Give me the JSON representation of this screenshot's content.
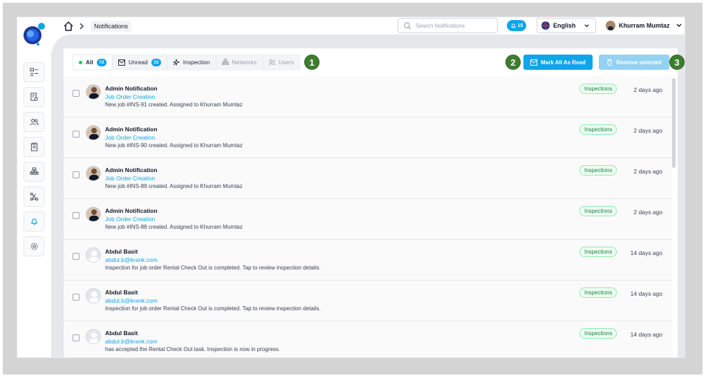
{
  "header": {
    "breadcrumb": "Notifications",
    "search_placeholder": "Search Notifications",
    "bell_count": "15",
    "language": "English",
    "user_name": "Khurram Mumtaz"
  },
  "sidebar": {
    "icons": [
      "dashboard-icon",
      "report-search-icon",
      "users-icon",
      "clipboard-icon",
      "network-icon",
      "workflow-icon",
      "bell-icon",
      "settings-icon"
    ],
    "active_index": 6
  },
  "tabs": [
    {
      "label": "All",
      "count": "72",
      "active": true
    },
    {
      "label": "Unread",
      "count": "15"
    },
    {
      "label": "Inspection"
    },
    {
      "label": "Networks"
    },
    {
      "label": "Users"
    }
  ],
  "markers": [
    "1",
    "2",
    "3"
  ],
  "actions": {
    "mark_all": "Mark All As Read",
    "remove": "Remove selected"
  },
  "notifications": [
    {
      "title": "Admin Notification",
      "subtitle": "Job Order Creation",
      "message": "New job #INS-91 created. Assigned to Khurram Mumtaz",
      "tag": "Inspections",
      "time": "2 days ago",
      "avatar": "photo"
    },
    {
      "title": "Admin Notification",
      "subtitle": "Job Order Creation",
      "message": "New job #INS-90 created. Assigned to Khurram Mumtaz",
      "tag": "Inspections",
      "time": "2 days ago",
      "avatar": "photo"
    },
    {
      "title": "Admin Notification",
      "subtitle": "Job Order Creation",
      "message": "New job #INS-89 created. Assigned to Khurram Mumtaz",
      "tag": "Inspections",
      "time": "2 days ago",
      "avatar": "photo"
    },
    {
      "title": "Admin Notification",
      "subtitle": "Job Order Creation",
      "message": "New job #INS-88 created. Assigned to Khurram Mumtaz",
      "tag": "Inspections",
      "time": "2 days ago",
      "avatar": "photo"
    },
    {
      "title": "Abdul Basit",
      "subtitle": "abdul.b@krank.com",
      "message": "Inspection for job order Rental Check Out is completed. Tap to review inspection details.",
      "tag": "Inspections",
      "time": "14 days ago",
      "avatar": "blank"
    },
    {
      "title": "Abdul Basit",
      "subtitle": "abdul.b@krank.com",
      "message": "Inspection for job order Rental Check Out is completed. Tap to review inspection details.",
      "tag": "Inspections",
      "time": "14 days ago",
      "avatar": "blank"
    },
    {
      "title": "Abdul Basit",
      "subtitle": "abdul.b@krank.com",
      "message": "has accepted the Rental Check Out task. Inspection is now in progress.",
      "tag": "Inspections",
      "time": "14 days ago",
      "avatar": "blank"
    }
  ]
}
